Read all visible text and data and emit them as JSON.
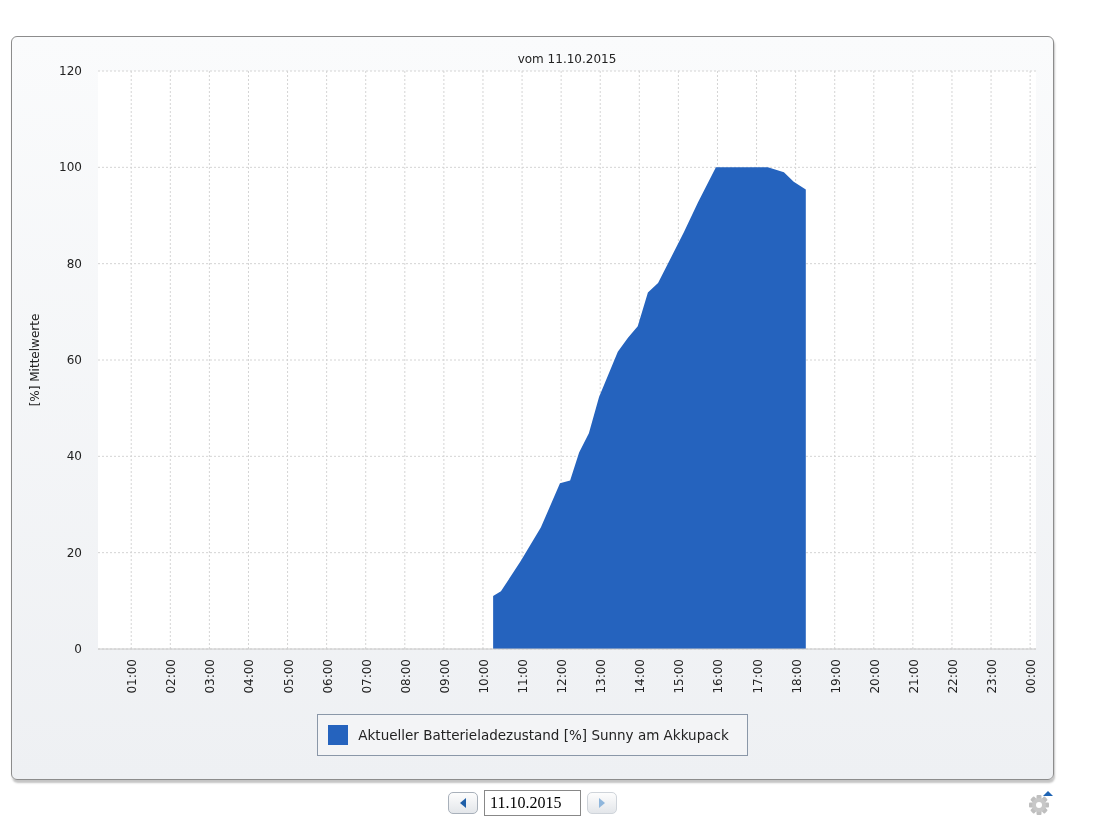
{
  "chart_panel": {
    "chart_data": {
      "type": "area",
      "title": "vom 11.10.2015",
      "ylabel": "[%] Mittelwerte",
      "x": [
        10.26,
        10.46,
        10.97,
        11.48,
        11.97,
        12.23,
        12.46,
        12.71,
        12.97,
        13.45,
        13.71,
        13.96,
        14.22,
        14.48,
        15.14,
        15.5,
        15.96,
        17.29,
        17.7,
        17.95,
        18.26
      ],
      "series": [
        {
          "name": "Aktueller Batterieladezustand [%] Sunny am Akkupack",
          "color": "#2563be",
          "values": [
            11,
            12,
            18.3,
            25.2,
            34.4,
            35,
            40.8,
            44.8,
            52.3,
            61.7,
            64.6,
            67,
            74,
            76,
            86.5,
            92.7,
            100,
            100,
            99,
            97,
            95.4
          ]
        }
      ],
      "xlim": [
        0.15,
        24.15
      ],
      "ylim": [
        0,
        120
      ],
      "xticks": [
        {
          "value": 1,
          "label": "01:00"
        },
        {
          "value": 2,
          "label": "02:00"
        },
        {
          "value": 3,
          "label": "03:00"
        },
        {
          "value": 4,
          "label": "04:00"
        },
        {
          "value": 5,
          "label": "05:00"
        },
        {
          "value": 6,
          "label": "06:00"
        },
        {
          "value": 7,
          "label": "07:00"
        },
        {
          "value": 8,
          "label": "08:00"
        },
        {
          "value": 9,
          "label": "09:00"
        },
        {
          "value": 10,
          "label": "10:00"
        },
        {
          "value": 11,
          "label": "11:00"
        },
        {
          "value": 12,
          "label": "12:00"
        },
        {
          "value": 13,
          "label": "13:00"
        },
        {
          "value": 14,
          "label": "14:00"
        },
        {
          "value": 15,
          "label": "15:00"
        },
        {
          "value": 16,
          "label": "16:00"
        },
        {
          "value": 17,
          "label": "17:00"
        },
        {
          "value": 18,
          "label": "18:00"
        },
        {
          "value": 19,
          "label": "19:00"
        },
        {
          "value": 20,
          "label": "20:00"
        },
        {
          "value": 21,
          "label": "21:00"
        },
        {
          "value": 22,
          "label": "22:00"
        },
        {
          "value": 23,
          "label": "23:00"
        },
        {
          "value": 24,
          "label": "00:00"
        }
      ],
      "yticks": [
        0,
        20,
        40,
        60,
        80,
        100,
        120
      ],
      "grid": true
    }
  },
  "date_nav": {
    "previous_disabled": false,
    "date": "11.10.2015",
    "next_disabled": true
  }
}
